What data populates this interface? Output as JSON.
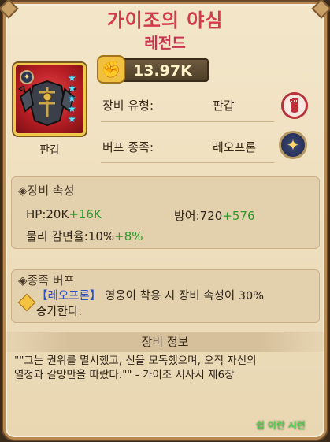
{
  "item": {
    "name": "가이조의 야심",
    "grade": "레전드",
    "type_label": "판갑",
    "star_count": 5,
    "power": "13.97K"
  },
  "info_rows": [
    {
      "label": "장비 유형:",
      "value": "판갑",
      "icon": "fist-icon"
    },
    {
      "label": "버프 종족:",
      "value": "레오프론",
      "icon": "star-compass-icon"
    }
  ],
  "attributes": {
    "heading": "장비 속성",
    "stats": [
      {
        "base": "HP:20K",
        "bonus": "+16K"
      },
      {
        "base": "방어:720",
        "bonus": "+576"
      },
      {
        "base": "물리 감면율:10%",
        "bonus": "+8%"
      }
    ]
  },
  "race_buff": {
    "heading": "종족 버프",
    "race_tag": "【레오프론】",
    "line1_rest": " 영웅이 착용 시 장비 속성이 30%",
    "line2": "증가한다."
  },
  "equipment_info": {
    "heading": "장비 정보",
    "quote_line1": "\"\"그는 권위를 멸시했고, 신을 모독했으며, 오직 자신의",
    "quote_line2": "열정과 갈망만을 따랐다.\"\" - 가이조 서사시 제6장"
  },
  "watermark": "쉽 이란 시련",
  "colors": {
    "title": "#d33a4b",
    "bonus": "#2a9a2a",
    "race_tag": "#2b4fc0",
    "star": "#5fe1ff",
    "item_bg": "#b81e24"
  }
}
